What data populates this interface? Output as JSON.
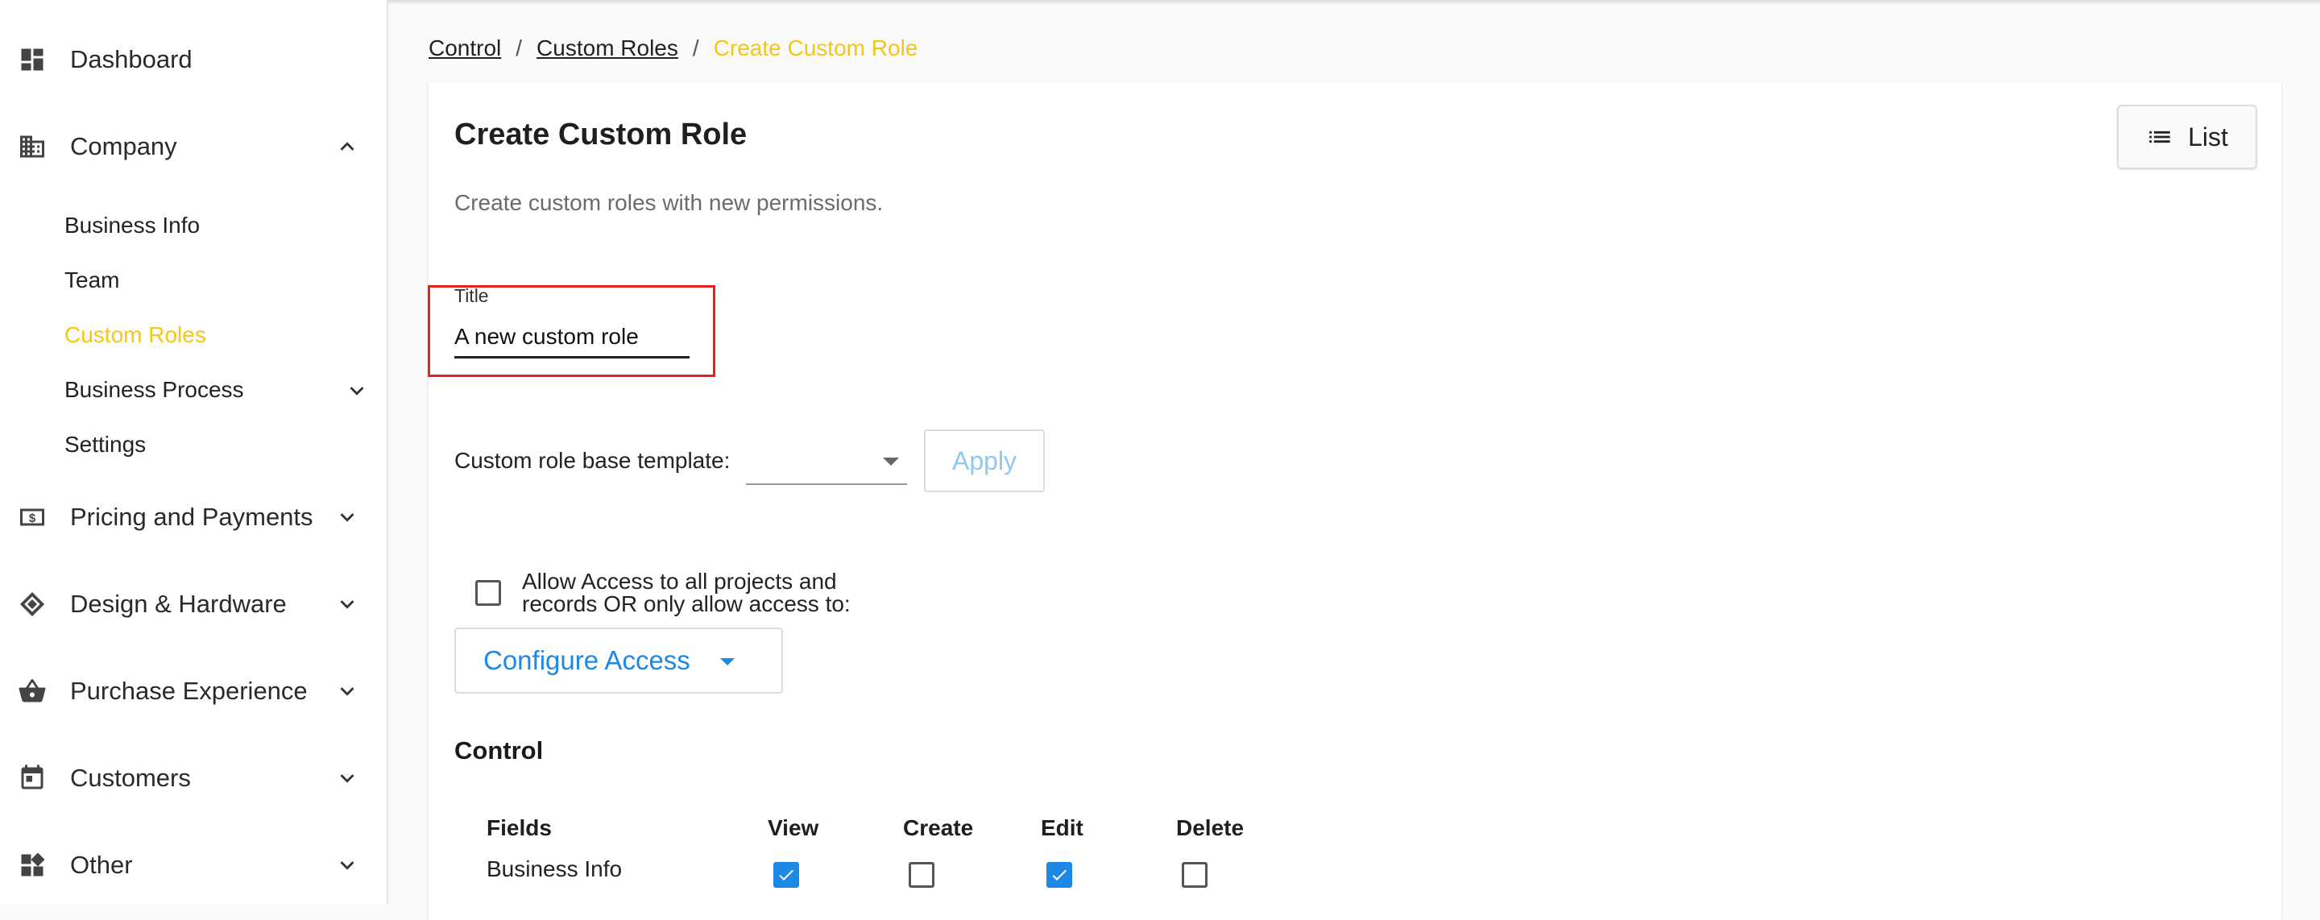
{
  "sidebar": {
    "items": [
      {
        "label": "Dashboard",
        "icon": "dashboard-icon"
      },
      {
        "label": "Company",
        "icon": "business-icon",
        "expanded": true
      },
      {
        "label": "Pricing and Payments",
        "icon": "money-icon"
      },
      {
        "label": "Design & Hardware",
        "icon": "design-icon"
      },
      {
        "label": "Purchase Experience",
        "icon": "basket-icon"
      },
      {
        "label": "Customers",
        "icon": "calendar-icon"
      },
      {
        "label": "Other",
        "icon": "widgets-icon"
      }
    ],
    "company_sub": [
      "Business Info",
      "Team",
      "Custom Roles",
      "Business Process",
      "Settings"
    ],
    "active_sub": "Custom Roles"
  },
  "breadcrumb": {
    "items": [
      "Control",
      "Custom Roles"
    ],
    "current": "Create Custom Role",
    "separator": "/"
  },
  "header": {
    "title": "Create Custom Role",
    "list_button": "List",
    "subtitle": "Create custom roles with new permissions."
  },
  "form": {
    "title_label": "Title",
    "title_value": "A new custom role",
    "template_label": "Custom role base template:",
    "template_value": "",
    "apply_label": "Apply",
    "access_checkbox_label": "Allow Access to all projects and records OR only allow access to:",
    "access_checked": false,
    "configure_access_label": "Configure Access"
  },
  "permissions": {
    "section_title": "Control",
    "columns": [
      "Fields",
      "View",
      "Create",
      "Edit",
      "Delete"
    ],
    "rows": [
      {
        "field": "Business Info",
        "view": true,
        "create": false,
        "edit": true,
        "delete": false
      }
    ]
  },
  "colors": {
    "accent_yellow": "#f5c518",
    "primary_blue": "#1e88e5",
    "highlight_red": "#e5231b"
  }
}
